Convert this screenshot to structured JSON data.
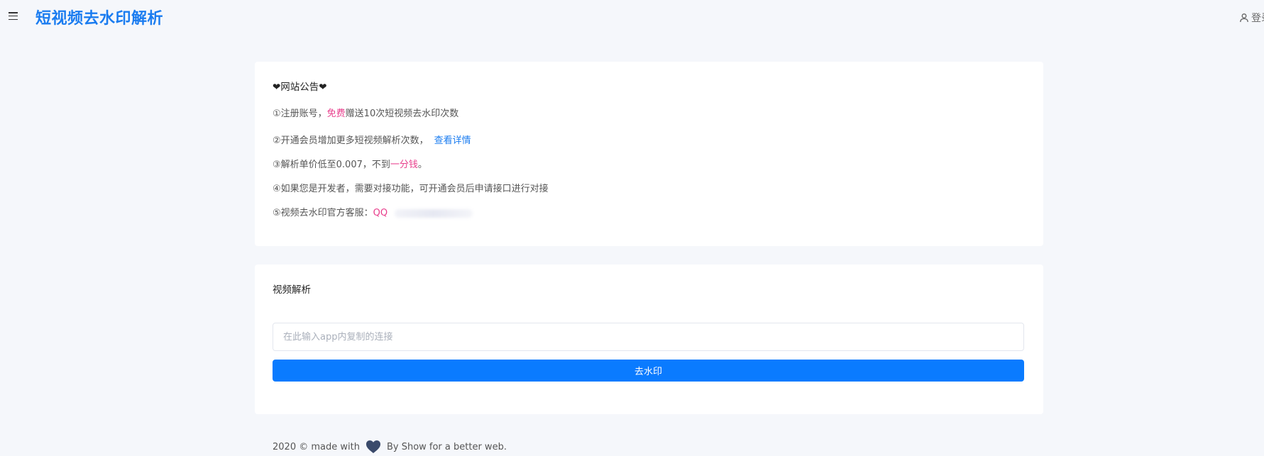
{
  "header": {
    "brand": "短视频去水印解析",
    "login_label": "登录"
  },
  "notice": {
    "title": "❤网站公告❤",
    "line1_prefix": "①注册账号，",
    "line1_highlight": "免费",
    "line1_suffix": "赠送10次短视频去水印次数",
    "line2_text": "②开通会员增加更多短视频解析次数，",
    "line2_link": "查看详情",
    "line3_prefix": "③解析单价低至0.007，不到",
    "line3_highlight": "一分钱",
    "line3_suffix": "。",
    "line4_text": "④如果您是开发者，需要对接功能，可开通会员后申请接口进行对接",
    "line5_prefix": "⑤视频去水印官方客服：",
    "line5_highlight": "QQ"
  },
  "parse": {
    "title": "视频解析",
    "input_placeholder": "在此输入app内复制的连接",
    "input_value": "",
    "button_label": "去水印"
  },
  "footer": {
    "prefix": "2020 © made with",
    "suffix": "By Show for a better web."
  },
  "colors": {
    "brand": "#1a7cf0",
    "button": "#0a7bff",
    "highlight": "#e83e8c",
    "heart": "#3a4a6b"
  },
  "icons": {
    "menu": "hamburger-menu-icon",
    "user": "user-icon",
    "heart": "heart-icon"
  }
}
